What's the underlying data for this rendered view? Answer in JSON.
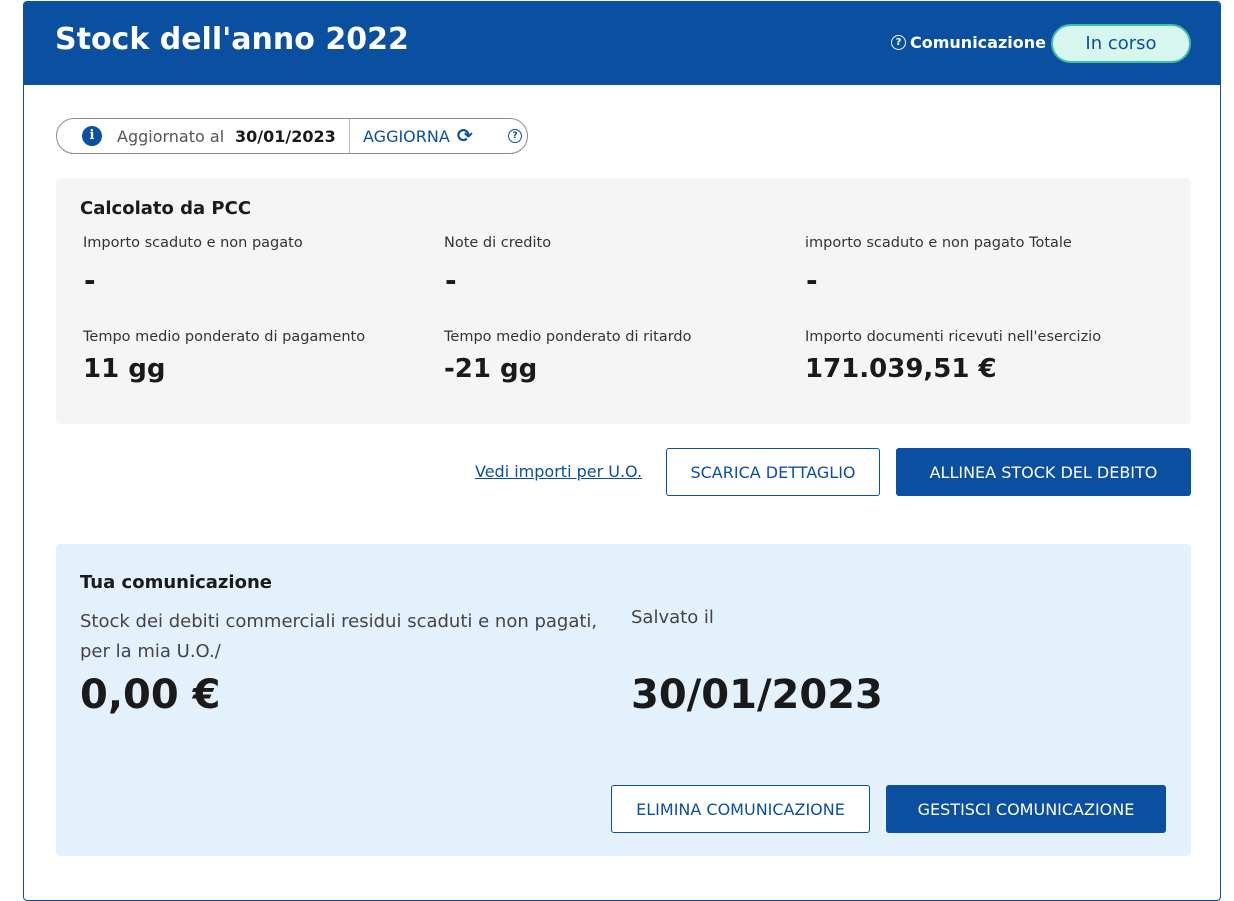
{
  "header": {
    "title": "Stock dell'anno 2022",
    "comm_link": "Comunicazione",
    "status": "In corso"
  },
  "update_bar": {
    "label": "Aggiornato al",
    "date": "30/01/2023",
    "button": "AGGIORNA"
  },
  "pcc": {
    "title": "Calcolato da PCC",
    "metrics": [
      {
        "label": "Importo scaduto e non pagato",
        "value": "-"
      },
      {
        "label": "Note di credito",
        "value": "-"
      },
      {
        "label": "importo scaduto e non pagato Totale",
        "value": "-"
      },
      {
        "label": "Tempo medio ponderato di pagamento",
        "value": "11 gg"
      },
      {
        "label": "Tempo medio ponderato di ritardo",
        "value": "-21 gg"
      },
      {
        "label": "Importo documenti ricevuti nell'esercizio",
        "value": "171.039,51 €"
      }
    ]
  },
  "actions": {
    "link_uo": "Vedi importi per U.O.",
    "download": "SCARICA DETTAGLIO",
    "align": "ALLINEA STOCK DEL DEBITO"
  },
  "communication": {
    "title": "Tua comunicazione",
    "description": "Stock dei debiti commerciali residui scaduti e non pagati, per la mia U.O./",
    "amount": "0,00 €",
    "saved_label": "Salvato il",
    "saved_date": "30/01/2023",
    "delete_button": "ELIMINA COMUNICAZIONE",
    "manage_button": "GESTISCI COMUNICAZIONE"
  },
  "icons": {
    "info": "info-icon",
    "refresh": "refresh-icon",
    "help": "question-circle-icon"
  },
  "colors": {
    "primary": "#0b4fa0",
    "status_bg": "#d7f6ee",
    "status_border": "#3cc0a0",
    "panel_gray": "#f5f5f5",
    "panel_blue": "#e3f1fd"
  }
}
